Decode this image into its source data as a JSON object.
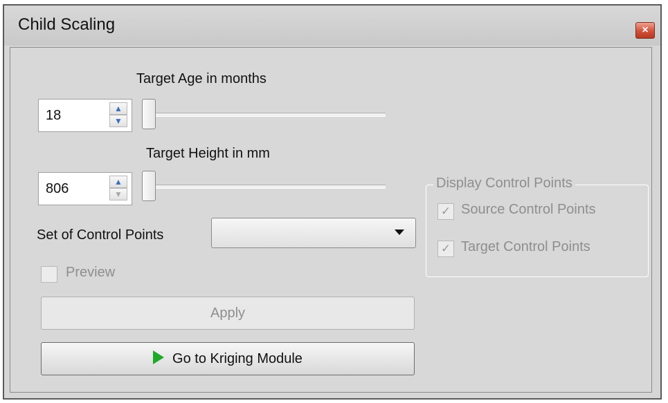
{
  "window": {
    "title": "Child Scaling",
    "close_label": "×"
  },
  "age": {
    "label": "Target Age in months",
    "value": "18",
    "slider_level": 0
  },
  "height": {
    "label": "Target Height in mm",
    "value": "806",
    "slider_level": 0
  },
  "control_points": {
    "label": "Set of Control Points",
    "selected": ""
  },
  "preview": {
    "label": "Preview",
    "checked": false,
    "enabled": false
  },
  "apply": {
    "label": "Apply",
    "enabled": false
  },
  "kriging": {
    "label": "Go to Kriging Module",
    "icon": "play-icon",
    "icon_color": "#1fa82a"
  },
  "display_group": {
    "title": "Display Control Points",
    "enabled": false,
    "items": [
      {
        "label": "Source Control Points",
        "checked": true,
        "check_glyph": "✓"
      },
      {
        "label": "Target Control Points",
        "checked": true,
        "check_glyph": "✓"
      }
    ]
  },
  "spin_icons": {
    "up": "▲",
    "down": "▼"
  }
}
